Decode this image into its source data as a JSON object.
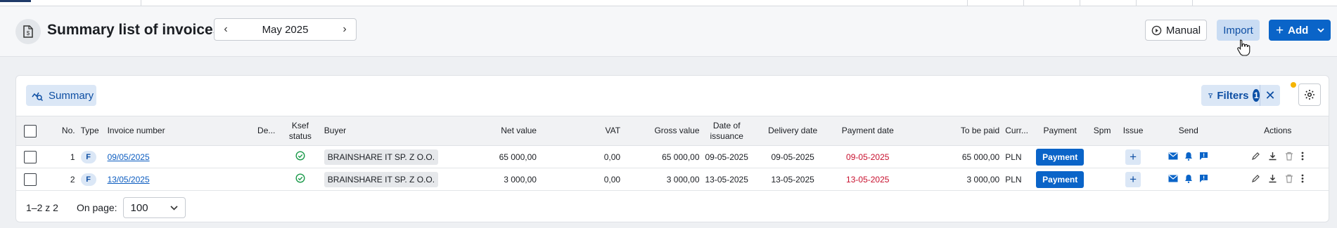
{
  "header": {
    "title": "Summary list of invoices",
    "month": "May 2025",
    "manual_label": "Manual",
    "import_label": "Import",
    "add_label": "Add"
  },
  "toolbar": {
    "summary_label": "Summary",
    "filters_label": "Filters",
    "filters_count": "1"
  },
  "table": {
    "columns": {
      "no": "No.",
      "type": "Type",
      "invoice_number": "Invoice number",
      "de": "De...",
      "ksef_status": "Ksef status",
      "buyer": "Buyer",
      "net_value": "Net value",
      "vat": "VAT",
      "gross_value": "Gross value",
      "date_of_issuance": "Date of issuance",
      "delivery_date": "Delivery date",
      "payment_date": "Payment date",
      "to_be_paid": "To be paid",
      "currency": "Curr...",
      "payment": "Payment",
      "spm": "Spm",
      "issue": "Issue",
      "send": "Send",
      "actions": "Actions"
    },
    "rows": [
      {
        "no": "1",
        "type": "F",
        "invoice_number": "09/05/2025",
        "buyer": "BRAINSHARE IT SP. Z O.O.",
        "net_value": "65 000,00",
        "vat": "0,00",
        "gross_value": "65 000,00",
        "date_of_issuance": "09-05-2025",
        "delivery_date": "09-05-2025",
        "payment_date": "09-05-2025",
        "to_be_paid": "65 000,00",
        "currency": "PLN",
        "payment_label": "Payment",
        "issue_label": "+"
      },
      {
        "no": "2",
        "type": "F",
        "invoice_number": "13/05/2025",
        "buyer": "BRAINSHARE IT SP. Z O.O.",
        "net_value": "3 000,00",
        "vat": "0,00",
        "gross_value": "3 000,00",
        "date_of_issuance": "13-05-2025",
        "delivery_date": "13-05-2025",
        "payment_date": "13-05-2025",
        "to_be_paid": "3 000,00",
        "currency": "PLN",
        "payment_label": "Payment",
        "issue_label": "+"
      }
    ]
  },
  "footer": {
    "range": "1–2 z 2",
    "on_page_label": "On page:",
    "page_size": "100"
  },
  "colors": {
    "primary": "#0a64c8",
    "light_accent": "#dbe7f6",
    "overdue": "#c8102e",
    "filter_dot": "#f5b400"
  }
}
